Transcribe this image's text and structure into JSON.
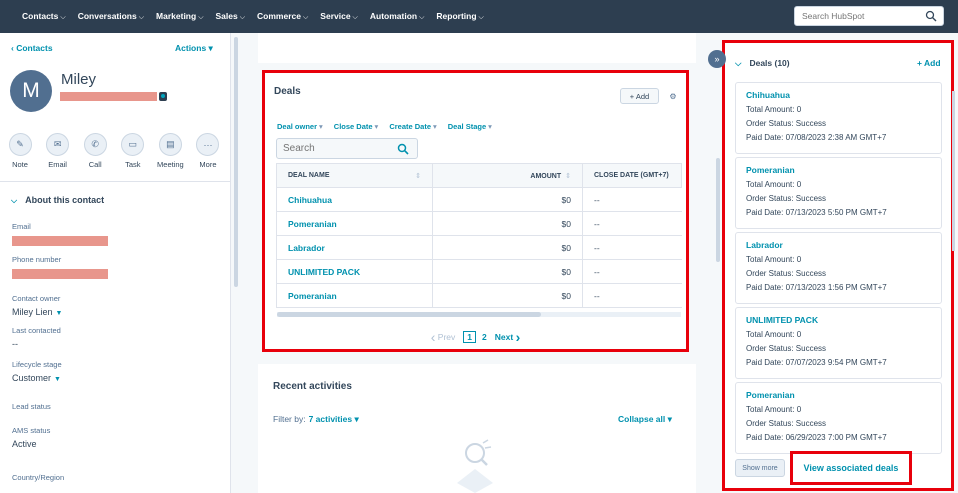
{
  "nav": {
    "items": [
      {
        "label": "Contacts"
      },
      {
        "label": "Conversations"
      },
      {
        "label": "Marketing"
      },
      {
        "label": "Sales"
      },
      {
        "label": "Commerce"
      },
      {
        "label": "Service"
      },
      {
        "label": "Automation"
      },
      {
        "label": "Reporting"
      }
    ],
    "search_placeholder": "Search HubSpot"
  },
  "contact": {
    "back_label": "‹ Contacts",
    "actions_label": "Actions ▾",
    "avatar_initial": "M",
    "name": "Miley",
    "actions": [
      {
        "label": "Note",
        "icon": "✎"
      },
      {
        "label": "Email",
        "icon": "✉"
      },
      {
        "label": "Call",
        "icon": "✆"
      },
      {
        "label": "Task",
        "icon": "▭"
      },
      {
        "label": "Meeting",
        "icon": "▤"
      },
      {
        "label": "More",
        "icon": "···"
      }
    ],
    "about_title": "About this contact",
    "props": {
      "email_label": "Email",
      "phone_label": "Phone number",
      "owner_label": "Contact owner",
      "owner_value": "Miley Lien",
      "last_contacted_label": "Last contacted",
      "last_contacted_value": "--",
      "lifecycle_label": "Lifecycle stage",
      "lifecycle_value": "Customer",
      "lead_status_label": "Lead status",
      "ams_label": "AMS status",
      "ams_value": "Active",
      "country_label": "Country/Region"
    }
  },
  "deals": {
    "title": "Deals",
    "add_label": "+ Add",
    "filters": [
      "Deal owner",
      "Close Date",
      "Create Date",
      "Deal Stage"
    ],
    "search_placeholder": "Search",
    "columns": [
      "DEAL NAME",
      "AMOUNT",
      "CLOSE DATE (GMT+7)"
    ],
    "rows": [
      {
        "name": "Chihuahua",
        "amount": "$0",
        "close": "--"
      },
      {
        "name": "Pomeranian",
        "amount": "$0",
        "close": "--"
      },
      {
        "name": "Labrador",
        "amount": "$0",
        "close": "--"
      },
      {
        "name": "UNLIMITED PACK",
        "amount": "$0",
        "close": "--"
      },
      {
        "name": "Pomeranian",
        "amount": "$0",
        "close": "--"
      }
    ],
    "pager": {
      "prev": "Prev",
      "current": "1",
      "other": "2",
      "next": "Next"
    }
  },
  "recent": {
    "title": "Recent activities",
    "filter_label": "Filter by:",
    "filter_value": "7 activities",
    "collapse_label": "Collapse all"
  },
  "right_panel": {
    "header": "Deals (10)",
    "add_label": "+ Add",
    "cards": [
      {
        "name": "Chihuahua",
        "amount": "Total Amount: 0",
        "status": "Order Status: Success",
        "paid": "Paid Date: 07/08/2023 2:38 AM GMT+7"
      },
      {
        "name": "Pomeranian",
        "amount": "Total Amount: 0",
        "status": "Order Status: Success",
        "paid": "Paid Date: 07/13/2023 5:50 PM GMT+7"
      },
      {
        "name": "Labrador",
        "amount": "Total Amount: 0",
        "status": "Order Status: Success",
        "paid": "Paid Date: 07/13/2023 1:56 PM GMT+7"
      },
      {
        "name": "UNLIMITED PACK",
        "amount": "Total Amount: 0",
        "status": "Order Status: Success",
        "paid": "Paid Date: 07/07/2023 9:54 PM GMT+7"
      },
      {
        "name": "Pomeranian",
        "amount": "Total Amount: 0",
        "status": "Order Status: Success",
        "paid": "Paid Date: 06/29/2023 7:00 PM GMT+7"
      }
    ],
    "show_more": "Show more",
    "view_associated": "View associated deals"
  },
  "colors": {
    "nav_bg": "#2d3e50",
    "link": "#0091ae",
    "highlight": "#e8000b",
    "redaction": "#e8968c"
  }
}
